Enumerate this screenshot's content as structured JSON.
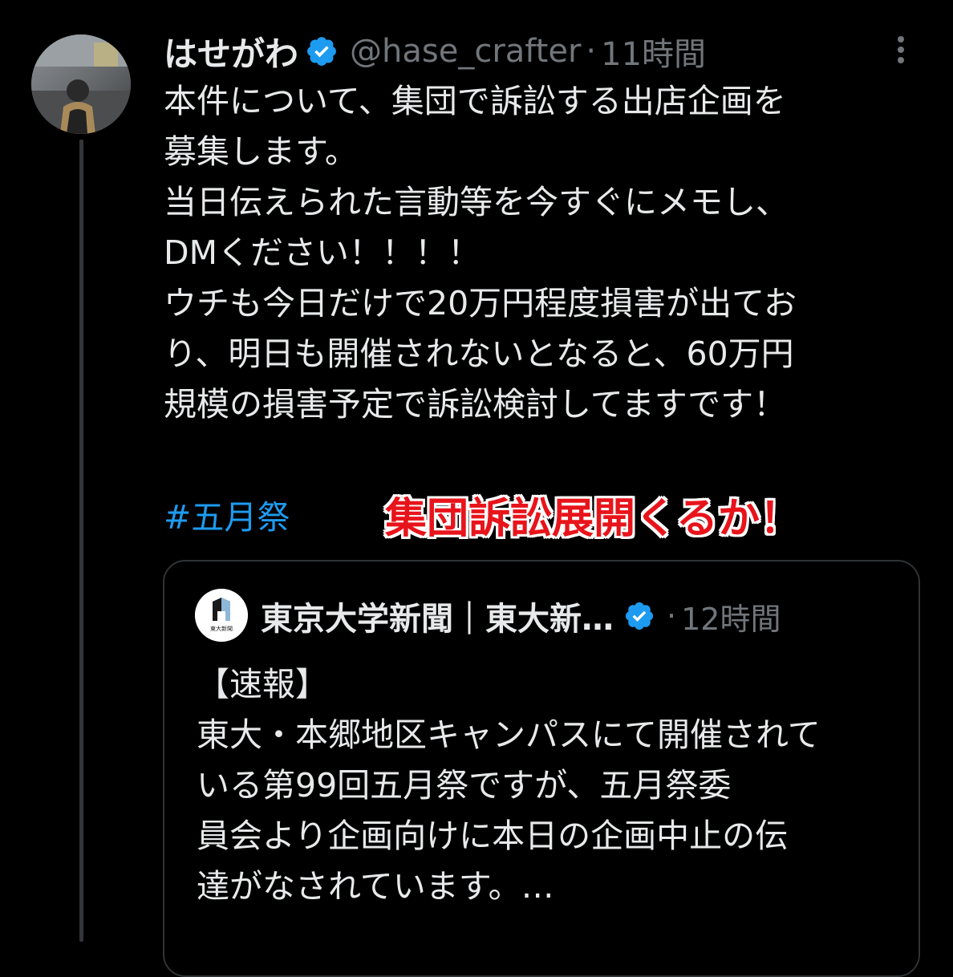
{
  "tweet": {
    "display_name": "はせがわ",
    "handle": "@hase_crafter",
    "separator": "·",
    "time": "11時間",
    "body_lines": [
      "本件について、集団で訴訟する出店企画を",
      "募集します。",
      "当日伝えられた言動等を今すぐにメモし、",
      "DMください！！！！",
      "ウチも今日だけで20万円程度損害が出てお",
      "り、明日も開催されないとなると、60万円",
      "規模の損害予定で訴訟検討してますです！"
    ],
    "hashtag": "#五月祭",
    "verified_color": "#1d9bf0"
  },
  "overlay": {
    "caption": "集団訴訟展開くるか！",
    "color": "#e8141b"
  },
  "quote": {
    "name": "東京大学新聞｜東大新…",
    "separator": "·",
    "time": "12時間",
    "logo_text": "東大新聞",
    "body_lines": [
      "【速報】",
      "東大・本郷地区キャンパスにて開催されて",
      "いる第99回五月祭ですが、五月祭委",
      "員会より企画向けに本日の企画中止の伝",
      "達がなされています。…"
    ]
  },
  "icons": {
    "avatar": "user-avatar-photo",
    "verified": "verified-badge-icon",
    "more": "more-options-icon",
    "quote_avatar": "todai-shimbun-logo"
  }
}
